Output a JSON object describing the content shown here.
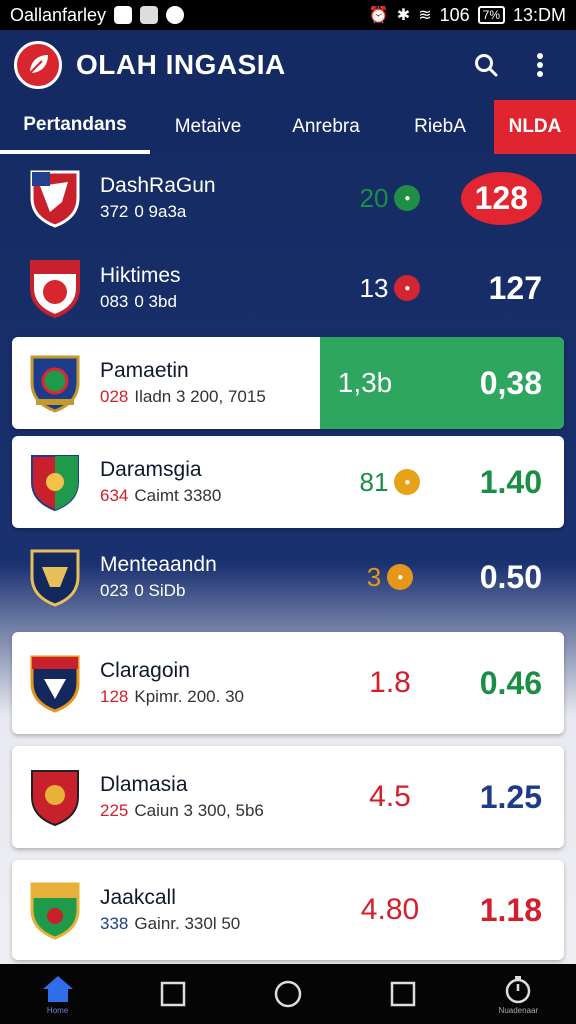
{
  "status_bar": {
    "carrier": "Oallanfarley",
    "network": "106",
    "battery": "7%",
    "time": "13:DM"
  },
  "app": {
    "title": "OLAH INGASIA",
    "colors": {
      "primary": "#152a63",
      "accent": "#e02530",
      "success": "#1b8e45"
    }
  },
  "tabs": [
    {
      "label": "Pertandans",
      "active": true
    },
    {
      "label": "Metaive"
    },
    {
      "label": "Anrebra"
    },
    {
      "label": "RiebA"
    },
    {
      "label": "NLDA",
      "live": true
    }
  ],
  "rows": [
    {
      "team": "DashRaGun",
      "code": "372",
      "detail": "0 9a3a",
      "odd1": "20",
      "chip_color": "#1e8f45",
      "odd2": "128",
      "style": "dark"
    },
    {
      "team": "Hiktimes",
      "code": "083",
      "detail": "0 3bd",
      "odd1": "13",
      "chip_color": "#d42532",
      "odd2": "127",
      "style": "dark"
    },
    {
      "team": "Pamaetin",
      "code": "028",
      "detail": "Iladn 3 200, 7015",
      "odd1": "1,3b",
      "odd2": "0,38",
      "style": "light-green"
    },
    {
      "team": "Daramsgia",
      "code": "634",
      "detail": "Caimt 3380",
      "odd1": "81",
      "chip_color": "#e8a21a",
      "odd2": "1.40",
      "style": "light"
    },
    {
      "team": "Menteaandn",
      "code": "023",
      "detail": "0 SiDb",
      "odd1": "3",
      "chip_color": "#e8961a",
      "odd2": "0.50",
      "style": "dark"
    },
    {
      "team": "Claragoin",
      "code": "128",
      "detail": "Kpimr. 200. 30",
      "odd1": "1.8",
      "odd2": "0.46",
      "style": "light"
    },
    {
      "team": "Dlamasia",
      "code": "225",
      "detail": "Caiun 3 300, 5b6",
      "odd1": "4.5",
      "odd2": "1.25",
      "style": "light"
    },
    {
      "team": "Jaakcall",
      "code": "338",
      "detail": "Gainr. 330l 50",
      "odd1": "4.80",
      "odd2": "1.18",
      "style": "light"
    }
  ],
  "nav": {
    "home_caption": "Home",
    "last_caption": "Nuadenaar"
  }
}
